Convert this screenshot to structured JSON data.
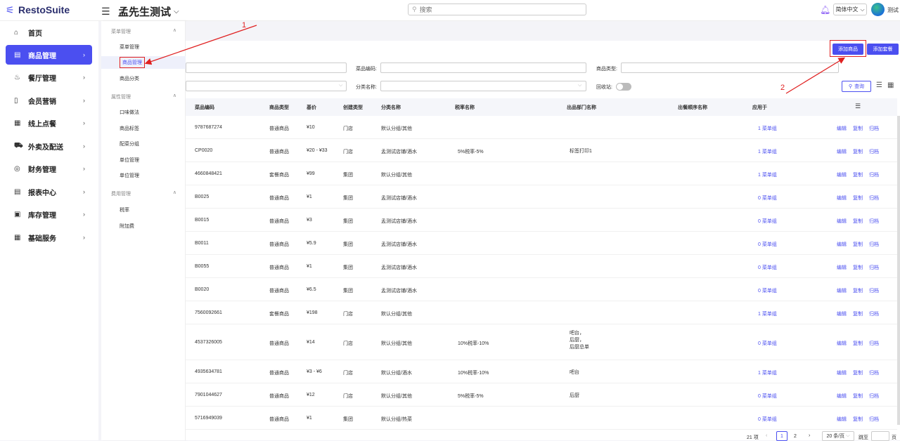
{
  "app": {
    "brand": "RestoSuite",
    "store_title": "孟先生测试",
    "user_name": "测试",
    "language": "简体中文"
  },
  "search": {
    "placeholder": "搜索"
  },
  "sidebar": {
    "items": [
      {
        "label": "首页",
        "icon": "home-icon"
      },
      {
        "label": "商品管理",
        "icon": "product-icon",
        "active": true
      },
      {
        "label": "餐厅管理",
        "icon": "restaurant-icon"
      },
      {
        "label": "会员营销",
        "icon": "member-icon"
      },
      {
        "label": "线上点餐",
        "icon": "online-order-icon"
      },
      {
        "label": "外卖及配送",
        "icon": "delivery-icon"
      },
      {
        "label": "财务管理",
        "icon": "finance-icon"
      },
      {
        "label": "报表中心",
        "icon": "report-icon"
      },
      {
        "label": "库存管理",
        "icon": "inventory-icon"
      },
      {
        "label": "基础服务",
        "icon": "grid-icon"
      }
    ]
  },
  "submenu": {
    "group1": "菜单管理",
    "items1": [
      "菜单管理",
      "商品管理",
      "商品分类"
    ],
    "group2": "属性管理",
    "items2": [
      "口味做法",
      "商品标签",
      "配菜分组",
      "单位管理",
      "单位管理"
    ],
    "group3": "费用管理",
    "items3": [
      "税率",
      "附加费"
    ]
  },
  "toolbar": {
    "add_product": "添加商品",
    "add_combo": "添加套餐",
    "query": "查询"
  },
  "filters": {
    "dish_code_label": "菜品编码:",
    "product_type_label": "商品类型:",
    "category_label": "分类名称:",
    "recycle_label": "回收站:"
  },
  "table": {
    "headers": [
      "菜品编码",
      "商品类型",
      "基价",
      "创建类型",
      "分类名称",
      "税率名称",
      "出品部门名称",
      "出餐顺序名称",
      "应用于"
    ],
    "action_labels": {
      "edit": "编辑",
      "copy": "复制",
      "archive": "归档"
    },
    "rows": [
      {
        "code": "9787687274",
        "type": "普通商品",
        "price": "¥10",
        "create": "门店",
        "category": "默认分组/其他",
        "tax": "",
        "dept": [],
        "apply": "1 菜单组"
      },
      {
        "code": "CP0020",
        "type": "普通商品",
        "price": "¥20 - ¥33",
        "create": "门店",
        "category": "孟测试店铺/酒水",
        "tax": "5%税率-5%",
        "dept": [
          "标签打印1"
        ],
        "apply": "1 菜单组"
      },
      {
        "code": "4660848421",
        "type": "套餐商品",
        "price": "¥99",
        "create": "集团",
        "category": "默认分组/其他",
        "tax": "",
        "dept": [],
        "apply": "1 菜单组"
      },
      {
        "code": "B0025",
        "type": "普通商品",
        "price": "¥1",
        "create": "集团",
        "category": "孟测试店铺/酒水",
        "tax": "",
        "dept": [],
        "apply": "0 菜单组"
      },
      {
        "code": "B0015",
        "type": "普通商品",
        "price": "¥3",
        "create": "集团",
        "category": "孟测试店铺/酒水",
        "tax": "",
        "dept": [],
        "apply": "0 菜单组"
      },
      {
        "code": "B0011",
        "type": "普通商品",
        "price": "¥5.9",
        "create": "集团",
        "category": "孟测试店铺/酒水",
        "tax": "",
        "dept": [],
        "apply": "0 菜单组"
      },
      {
        "code": "B0055",
        "type": "普通商品",
        "price": "¥1",
        "create": "集团",
        "category": "孟测试店铺/酒水",
        "tax": "",
        "dept": [],
        "apply": "0 菜单组"
      },
      {
        "code": "B0020",
        "type": "普通商品",
        "price": "¥6.5",
        "create": "集团",
        "category": "孟测试店铺/酒水",
        "tax": "",
        "dept": [],
        "apply": "0 菜单组"
      },
      {
        "code": "7560092661",
        "type": "套餐商品",
        "price": "¥198",
        "create": "门店",
        "category": "默认分组/其他",
        "tax": "",
        "dept": [],
        "apply": "1 菜单组"
      },
      {
        "code": "4537326005",
        "type": "普通商品",
        "price": "¥14",
        "create": "门店",
        "category": "默认分组/其他",
        "tax": "10%税率-10%",
        "dept": [
          "吧台，",
          "后厨，",
          "后厨总单"
        ],
        "apply": "0 菜单组"
      },
      {
        "code": "4935634781",
        "type": "普通商品",
        "price": "¥3 - ¥6",
        "create": "门店",
        "category": "默认分组/酒水",
        "tax": "10%税率-10%",
        "dept": [
          "吧台"
        ],
        "apply": "1 菜单组"
      },
      {
        "code": "7901044627",
        "type": "普通商品",
        "price": "¥12",
        "create": "门店",
        "category": "默认分组/其他",
        "tax": "5%税率-5%",
        "dept": [
          "后厨"
        ],
        "apply": "0 菜单组"
      },
      {
        "code": "5716949039",
        "type": "普通商品",
        "price": "¥1",
        "create": "集团",
        "category": "默认分组/热菜",
        "tax": "",
        "dept": [],
        "apply": "0 菜单组"
      }
    ]
  },
  "pagination": {
    "total": "21 项",
    "current": "1",
    "next_page": "2",
    "per_page": "20 条/页",
    "jump_label": "跳至",
    "page_suffix": "页"
  },
  "annotations": {
    "step1": "1",
    "step2": "2"
  },
  "colors": {
    "accent": "#4b4ff0",
    "annotation": "#e02020"
  }
}
